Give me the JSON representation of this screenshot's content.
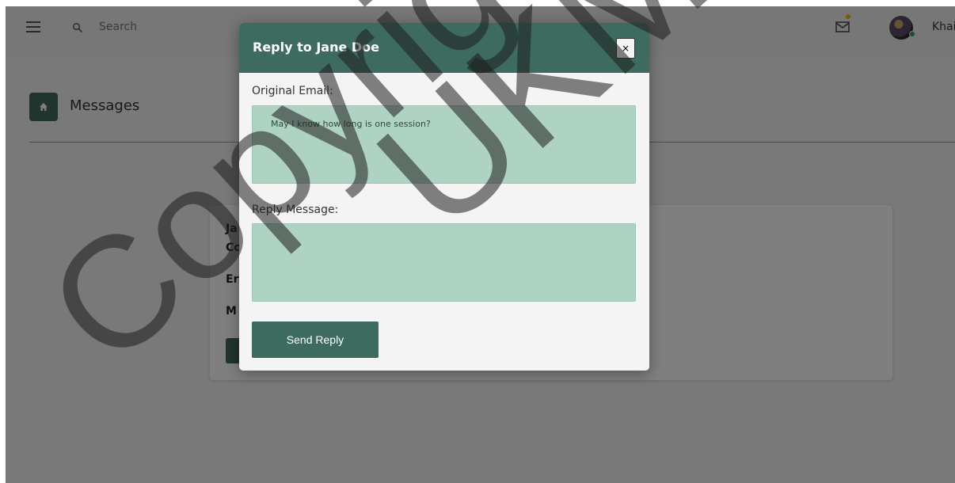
{
  "topbar": {
    "search_placeholder": "Search",
    "user_name": "Khai"
  },
  "page": {
    "title": "Messages"
  },
  "card": {
    "lines": [
      "Ja",
      "Co",
      "Er",
      "M"
    ]
  },
  "modal": {
    "title": "Reply to Jane Doe",
    "close_label": "×",
    "original_label": "Original Email:",
    "original_text": "May I know how long is one session?",
    "reply_label": "Reply Message:",
    "reply_value": "",
    "send_label": "Send Reply"
  },
  "watermark": {
    "line1": "Copyright",
    "line2": "UKM"
  },
  "colors": {
    "accent": "#3e6b5f",
    "field_bg": "#afd3c3",
    "notification_dot": "#f0b400",
    "online_dot": "#2f9a6a"
  }
}
